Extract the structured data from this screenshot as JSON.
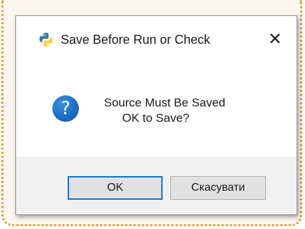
{
  "dialog": {
    "title": "Save Before Run or Check",
    "close_glyph": "✕",
    "icon": "python-icon",
    "message_icon": "question-icon",
    "message_icon_glyph": "?",
    "message_line1": "Source Must Be Saved",
    "message_line2": "OK to Save?",
    "ok_label": "OK",
    "cancel_label": "Скасувати"
  },
  "colors": {
    "frame_border": "#e69a3c",
    "frame_bg": "#fbf7ee",
    "footer_bg": "#f0f0f0",
    "default_button_border": "#0a74d6",
    "question_icon": "#1466be"
  }
}
